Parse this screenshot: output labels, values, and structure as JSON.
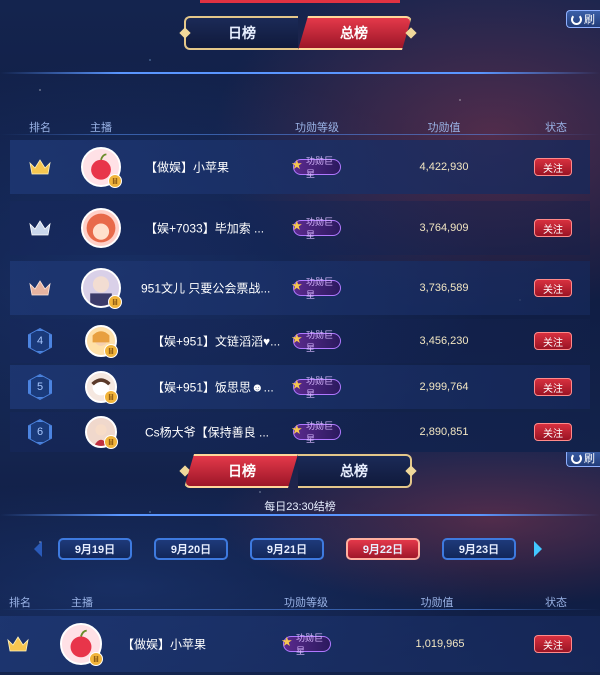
{
  "refresh_label": "刷",
  "total_board": {
    "tabs": [
      {
        "label": "日榜",
        "active": false
      },
      {
        "label": "总榜",
        "active": true
      }
    ],
    "columns": [
      "排名",
      "主播",
      "功勋等级",
      "功勋值",
      "状态"
    ],
    "rows": [
      {
        "rank": "1",
        "rank_style": "crown-gold",
        "name": "【做娱】小苹果",
        "level": "功勋巨星",
        "score": "4,422,930",
        "action": "关注",
        "avatar_color": "#ffe1e6"
      },
      {
        "rank": "2",
        "rank_style": "crown-silver",
        "name": "【娱+7033】毕加索 ...",
        "level": "功勋巨星",
        "score": "3,764,909",
        "action": "关注",
        "avatar_color": "#ffd0c8"
      },
      {
        "rank": "3",
        "rank_style": "crown-bronze",
        "name": "951文儿 只要公会票战...",
        "level": "功勋巨星",
        "score": "3,736,589",
        "action": "关注",
        "avatar_color": "#d9d0e8"
      },
      {
        "rank": "4",
        "rank_style": "hex",
        "name": "【娱+951】文链滔滔♥...",
        "level": "功勋巨星",
        "score": "3,456,230",
        "action": "关注",
        "avatar_color": "#ffe0a8"
      },
      {
        "rank": "5",
        "rank_style": "hex",
        "name": "【娱+951】饭思思☻...",
        "level": "功勋巨星",
        "score": "2,999,764",
        "action": "关注",
        "avatar_color": "#f5e8e0"
      },
      {
        "rank": "6",
        "rank_style": "hex",
        "name": "Cs杨大爷【保持善良 ...",
        "level": "功勋巨星",
        "score": "2,890,851",
        "action": "关注",
        "avatar_color": "#f0d8cc"
      }
    ]
  },
  "daily_board": {
    "tabs": [
      {
        "label": "日榜",
        "active": true
      },
      {
        "label": "总榜",
        "active": false
      }
    ],
    "end_note": "每日23:30结榜",
    "dates": [
      {
        "label": "9月19日",
        "active": false
      },
      {
        "label": "9月20日",
        "active": false
      },
      {
        "label": "9月21日",
        "active": false
      },
      {
        "label": "9月22日",
        "active": true
      },
      {
        "label": "9月23日",
        "active": false
      }
    ],
    "columns": [
      "排名",
      "主播",
      "功勋等级",
      "功勋值",
      "状态"
    ],
    "rows": [
      {
        "rank": "1",
        "rank_style": "crown-gold",
        "name": "【做娱】小苹果",
        "level": "功勋巨星",
        "score": "1,019,965",
        "action": "关注",
        "avatar_color": "#ffe1e6"
      }
    ]
  }
}
